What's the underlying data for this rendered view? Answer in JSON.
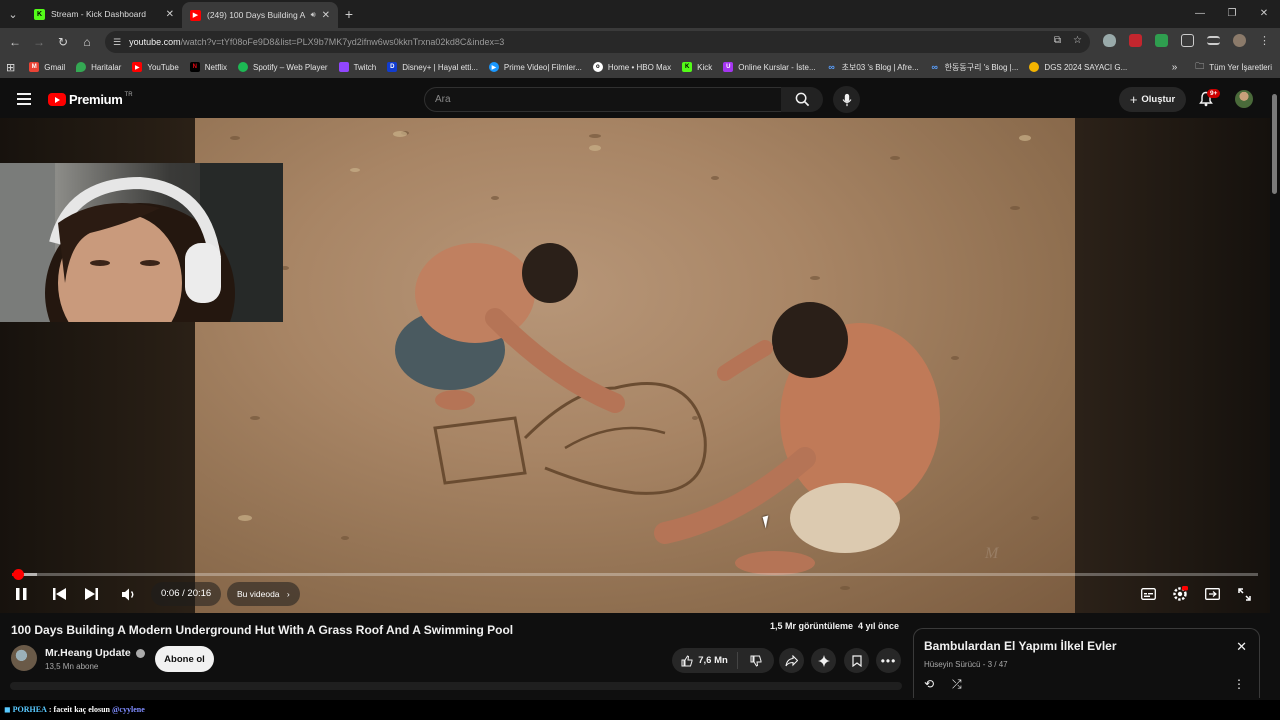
{
  "browser": {
    "tabs": [
      {
        "title": "Stream - Kick Dashboard",
        "favicon": "kick-icon",
        "color": "#53fc18",
        "active": false
      },
      {
        "title": "(249) 100 Days Building A M",
        "favicon": "youtube-icon",
        "color": "#ff0000",
        "active": true,
        "audio": true
      }
    ],
    "url_host": "youtube.com",
    "url_path": "/watch?v=tYf08oFe9D8&list=PLX9b7MK7yd2ifnw6ws0kknTrxna02kd8C&index=3",
    "bookmarks": [
      {
        "label": "Gmail",
        "icon": "gmail-icon",
        "color": "#ea4335"
      },
      {
        "label": "Haritalar",
        "icon": "maps-icon",
        "color": "#34a853"
      },
      {
        "label": "YouTube",
        "icon": "youtube-icon",
        "color": "#ff0000"
      },
      {
        "label": "Netflix",
        "icon": "netflix-icon",
        "color": "#e50914"
      },
      {
        "label": "Spotify – Web Player",
        "icon": "spotify-icon",
        "color": "#1db954"
      },
      {
        "label": "Twitch",
        "icon": "twitch-icon",
        "color": "#9146ff"
      },
      {
        "label": "Disney+ | Hayal etti...",
        "icon": "disney-icon",
        "color": "#113ccf"
      },
      {
        "label": "Prime Video| Filmler...",
        "icon": "prime-icon",
        "color": "#1a98ff"
      },
      {
        "label": "Home • HBO Max",
        "icon": "hbo-icon",
        "color": "#ffffff"
      },
      {
        "label": "Kick",
        "icon": "kick-icon",
        "color": "#53fc18"
      },
      {
        "label": "Online Kurslar - İste...",
        "icon": "udemy-icon",
        "color": "#a435f0"
      },
      {
        "label": "초보03 's Blog | Afre...",
        "icon": "blog-icon",
        "color": "#5aa0ff"
      },
      {
        "label": "한동동구리 's Blog |...",
        "icon": "blog-icon",
        "color": "#5aa0ff"
      },
      {
        "label": "DGS 2024 SAYACI G...",
        "icon": "pin-icon",
        "color": "#f4b400"
      }
    ],
    "bookmarks_overflow": "»",
    "all_bookmarks": "Tüm Yer İşaretleri"
  },
  "youtube": {
    "logo_text": "Premium",
    "logo_region": "TR",
    "search_placeholder": "Ara",
    "create_label": "Oluştur",
    "notification_count": "9+"
  },
  "player": {
    "current_time": "0:06",
    "duration": "20:16",
    "time_display": "0:06 / 20:16",
    "chapter_label": "Bu videoda",
    "progress_fraction": 0.005,
    "buffer_fraction": 0.02
  },
  "video": {
    "title": "100 Days Building A Modern Underground Hut With A Grass Roof And A Swimming Pool",
    "views": "1,5 Mr görüntüleme",
    "age": "4 yıl önce",
    "channel_name": "Mr.Heang Update",
    "subscribers": "13,5 Mn abone",
    "subscribe_label": "Abone ol",
    "likes": "7,6 Mn"
  },
  "playlist": {
    "title": "Bambulardan El Yapımı İlkel Evler",
    "owner": "Hüseyin Sürücü",
    "position": "3 / 47"
  },
  "ticker": {
    "user": "PORHEA",
    "message": ": faceit kaç elosun",
    "mention": "@cyylene"
  }
}
